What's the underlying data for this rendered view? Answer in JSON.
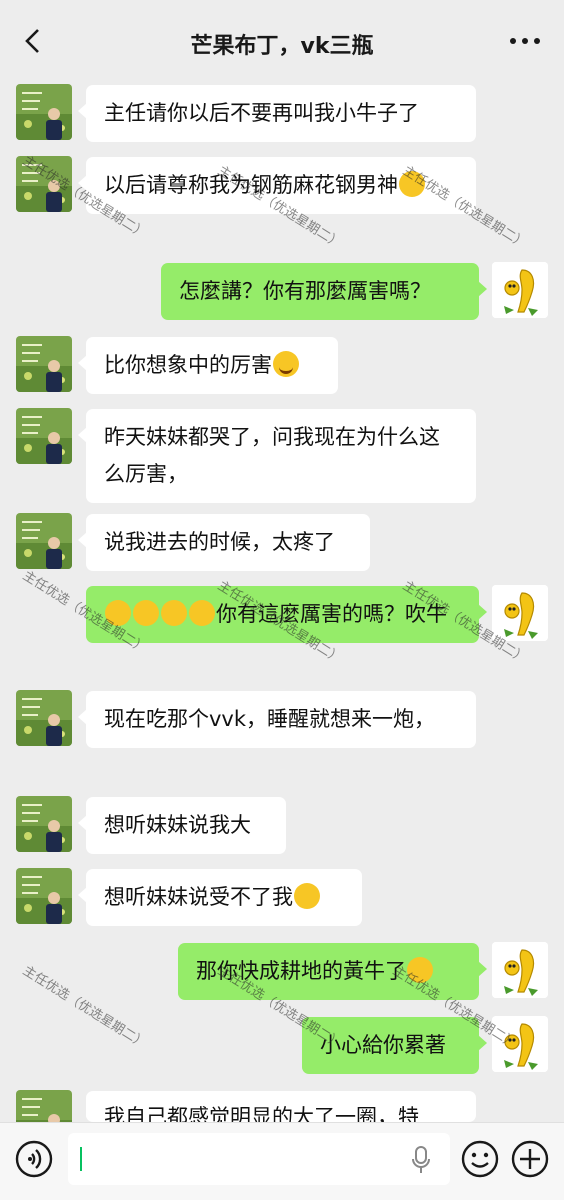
{
  "header": {
    "title": "芒果布丁，vk三瓶",
    "back_icon": "chevron-left-icon",
    "more_icon": "more-dots-icon"
  },
  "watermark": "主任优选（优选星期二）",
  "messages": [
    {
      "side": "left",
      "text": "主任请你以后不要再叫我小牛子了",
      "emoji": []
    },
    {
      "side": "left",
      "text": "以后请尊称我为钢筋麻花钢男神",
      "emoji": [
        "grin"
      ]
    },
    {
      "side": "right",
      "text": "怎麼講？你有那麼厲害嗎？",
      "emoji": []
    },
    {
      "side": "left",
      "text": "比你想象中的厉害",
      "emoji": [
        "smile"
      ]
    },
    {
      "side": "left",
      "text": "昨天妹妹都哭了，问我现在为什么这么厉害，",
      "emoji": []
    },
    {
      "side": "left",
      "text": "说我进去的时候，太疼了",
      "emoji": []
    },
    {
      "side": "right",
      "text": "你有這麼厲害的嗎？吹牛",
      "emoji": [
        "laugh",
        "laugh",
        "laugh",
        "laugh"
      ]
    },
    {
      "side": "left",
      "text": "现在吃那个vvk，睡醒就想来一炮，",
      "emoji": []
    },
    {
      "side": "left",
      "text": "想听妹妹说我大",
      "emoji": []
    },
    {
      "side": "left",
      "text": "想听妹妹说受不了我",
      "emoji": [
        "shy"
      ]
    },
    {
      "side": "right",
      "text": "那你快成耕地的黃牛了",
      "emoji": [
        "sad"
      ]
    },
    {
      "side": "right",
      "text": "小心給你累著",
      "emoji": []
    },
    {
      "side": "left",
      "text": "我自己都感觉明显的大了一圈，特",
      "emoji": []
    }
  ],
  "bottom_bar": {
    "voice_icon": "voice-icon",
    "input_value": "",
    "mic_icon": "mic-icon",
    "emoji_icon": "emoji-face-icon",
    "plus_icon": "plus-icon"
  },
  "colors": {
    "background": "#ededed",
    "bubble_self": "#95ec69",
    "bubble_other": "#ffffff",
    "caret": "#07c160"
  }
}
